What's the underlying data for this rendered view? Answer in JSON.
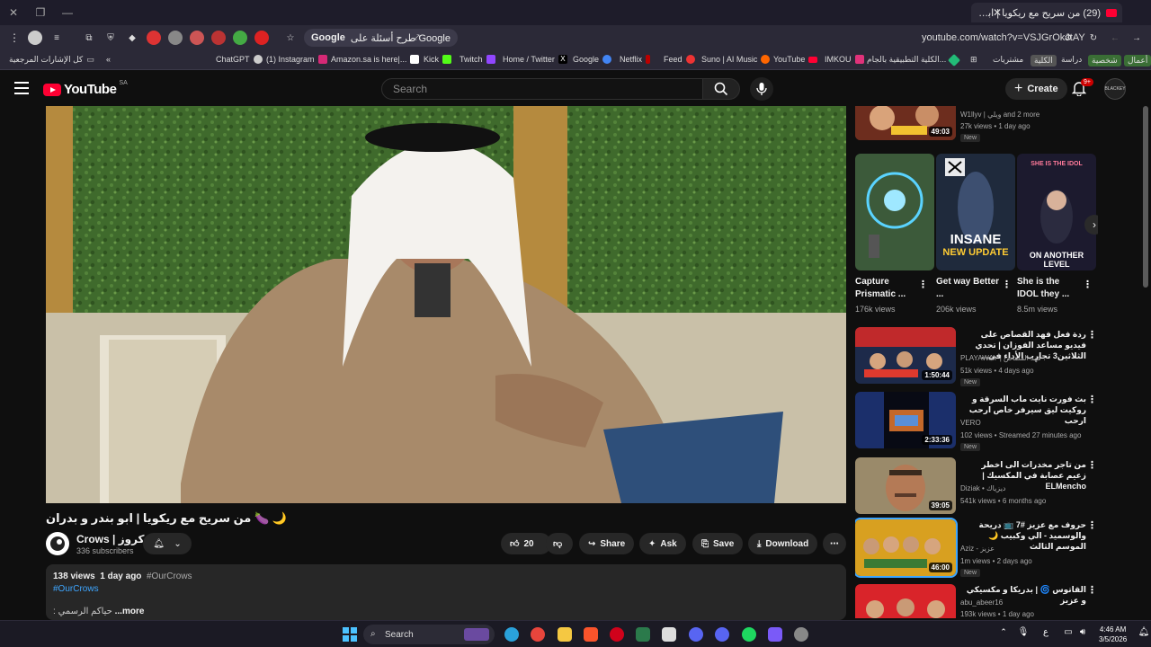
{
  "browser": {
    "tab_title": "(29) من سريح مع ريكويا | ابو بند...",
    "url": "youtube.com/watch?v=VSJGrOkJtAY",
    "google_button": "طرح أسئلة على Google",
    "bookmarks": [
      {
        "label": "أعمال",
        "color": "#3a6e35"
      },
      {
        "label": "شخصية",
        "color": "#3a6e35"
      },
      {
        "label": "دراسة",
        "color": ""
      },
      {
        "label": "الكلية",
        "color": ""
      },
      {
        "label": "مشتريات",
        "color": ""
      },
      {
        "label": "الكلية التطبيقية بالجام...",
        "color": "#2b7"
      },
      {
        "label": "IMKOU",
        "color": "#e0327a"
      },
      {
        "label": "YouTube",
        "color": "#ff0033"
      },
      {
        "label": "Suno | AI Music",
        "color": "#f60"
      },
      {
        "label": "Feed",
        "color": "#e33"
      },
      {
        "label": "Netflix",
        "color": "#b00"
      },
      {
        "label": "Google",
        "color": "#4285f4"
      },
      {
        "label": "Home / Twitter",
        "color": "#fff"
      },
      {
        "label": "Twitch",
        "color": "#9146ff"
      },
      {
        "label": "Kick",
        "color": "#53fc18"
      },
      {
        "label": "Amazon.sa is here|...",
        "color": "#fff"
      },
      {
        "label": "(1) Instagram",
        "color": "#d62976"
      },
      {
        "label": "ChatGPT",
        "color": "#ccc"
      }
    ],
    "all_bookmarks": "كل الإشارات المرجعية"
  },
  "header": {
    "logo_word": "YouTube",
    "country": "SA",
    "search_placeholder": "Search",
    "create_label": "Create",
    "notif_count": "9+",
    "avatar_text": "BLACKEY"
  },
  "video": {
    "title": "🌙 🍆 من سريح مع ريكويا | ابو بندر و بدران",
    "channel": "Crows | كروز",
    "subscribers": "336 subscribers",
    "likes": "20",
    "share": "Share",
    "ask": "Ask",
    "save": "Save",
    "download": "Download",
    "views": "138 views",
    "date": "1 day ago",
    "hashtag1": "#OurCrows",
    "hashtag2": "#OurCrows",
    "desc_snippet": ": حياكم الرسمي",
    "more": "...more"
  },
  "sidebar": {
    "top_item": {
      "channel": "W1llyv | ويلي and 2 more",
      "views": "27k views • 1 day ago",
      "new": "New",
      "duration": "49:03"
    },
    "shorts": [
      {
        "title": "Capture Prismatic ...",
        "views": "176k views"
      },
      {
        "title": "Get way Better ...",
        "views": "206k views"
      },
      {
        "title": "She is the IDOL they ...",
        "views": "8.5m views"
      }
    ],
    "shorts_text": [
      "INSANE",
      "NEW UPDATE",
      "SHE IS THE IDOL",
      "ON ANOTHER LEVEL"
    ],
    "videos": [
      {
        "title": "ردة فعل فهد القصاص على فيديو مساعد الفوزان | تحدي الثلاثين3 تجارب الأداء في...",
        "channel": "PLAYAWAY | فهد القصاص",
        "views": "51k views • 4 days ago",
        "new": "New",
        "duration": "1:50:44"
      },
      {
        "title": "بث فورت نايت ماب السرقة و روكيت ليق سيرفر خاص ارحب ارحب",
        "channel": "VERO",
        "views": "102 views • Streamed 27 minutes ago",
        "new": "New",
        "duration": "2:33:36"
      },
      {
        "title": "من تاجر مخدرات الى اخطر زعيم عصابة في المكسيك | ELMencho",
        "channel": "Diziak • ديزياك",
        "views": "541k views • 6 months ago",
        "new": "",
        "duration": "39:05"
      },
      {
        "title": "حروف مع عزيز #7 📺 دريحة والوسميد - الي وكبيب 🌙 الموسم الثالث",
        "channel": "Aziz - عزيز",
        "views": "1m views • 2 days ago",
        "new": "New",
        "duration": "46:00"
      },
      {
        "title": "القاتوس 🌀 | بدريكا و مكسيكي و عزيز",
        "channel": "abu_abeer16",
        "views": "193k views • 1 day ago",
        "new": "",
        "duration": ""
      }
    ]
  },
  "taskbar": {
    "search": "Search",
    "time": "4:46 AM",
    "date": "3/5/2026",
    "lang": "ع"
  }
}
